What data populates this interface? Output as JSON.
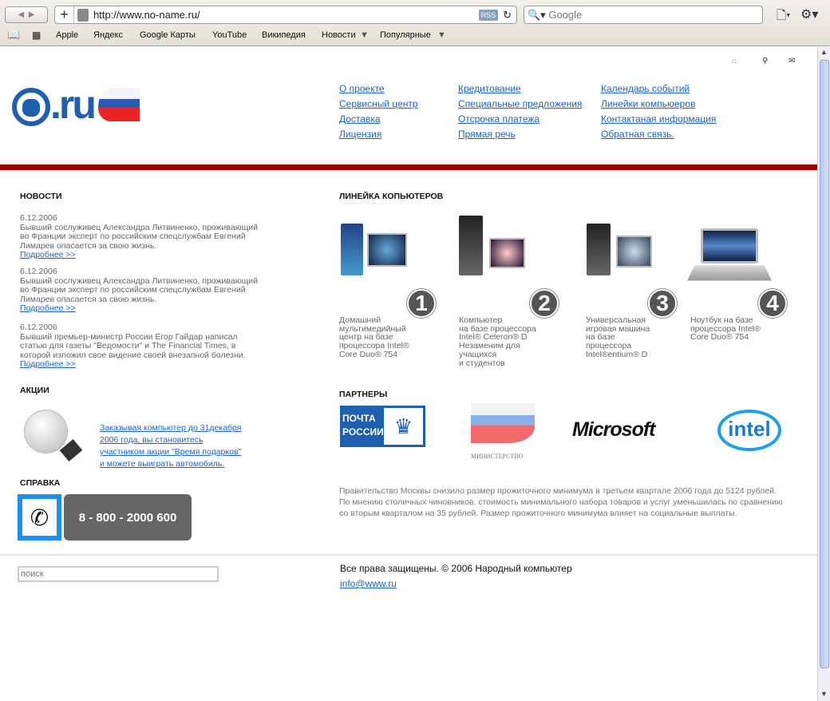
{
  "browser": {
    "url": "http://www.no-name.ru/",
    "rss": "RSS",
    "search_placeholder": "Google",
    "bookmarks": [
      "Apple",
      "Яндекс",
      "Google Карты",
      "YouTube",
      "Википедия",
      "Новости",
      "Популярные"
    ]
  },
  "nav": {
    "col1": [
      "О проекте",
      "Сервисный центр",
      "Доставка",
      "Лицензия"
    ],
    "col2": [
      "Кредитование",
      "Специальные предложения",
      "Отсрочка платежа",
      "Прямая речь"
    ],
    "col3": [
      "Календарь событий",
      "Линейки компьюеров",
      "Контактаная информация",
      "Обратная связь."
    ]
  },
  "logo_text": ".ru",
  "news": {
    "title": "НОВОСТИ",
    "items": [
      {
        "date": "6.12.2006",
        "text": "Бывший сослуживец Александра Литвиненко, проживающий во Франции эксперт по российским спецслужбам Евгений Лимарев опасается за свою жизнь.",
        "more": "Подробнее >>"
      },
      {
        "date": "6.12.2006",
        "text": "Бывший сослуживец Александра Литвиненко, проживающий во Франции эксперт по российским спецслужбам Евгений Лимарев опасается за свою жизнь.",
        "more": "Подробнее >>"
      },
      {
        "date": "6.12.2006",
        "text": "Бывший премьер-министр России Егор Гайдар написал статью для газеты \"Ведомости\" и The Financial Times, в которой изложил свое видение своей внезапной болезни.",
        "more": "Подробнее >>"
      }
    ]
  },
  "promo": {
    "title": "АКЦИИ",
    "text": "Заказывая компьютер до 31декабря 2006 года, вы становитесь участником акции \"Время подарков\" и можете выиграть автомобиль."
  },
  "help": {
    "title": "СПРАВКА",
    "phone": "8 - 800 - 2000 600"
  },
  "products": {
    "title": "ЛИНЕЙКА КОПЬЮТЕРОВ",
    "items": [
      {
        "num": "1",
        "lines": [
          "Домашний",
          "мультимедийный",
          "центр на базе",
          "процессора Intel®",
          "Core Duo® 754"
        ]
      },
      {
        "num": "2",
        "lines": [
          "Компьютер",
          "на базе процессора",
          "Intel® Celeron® D",
          "Незаменим для",
          "учащихся",
          "и студентов"
        ]
      },
      {
        "num": "3",
        "lines": [
          "Универсальная",
          "игровая машина",
          "на базе",
          "процессора",
          "Intel®entium® D"
        ]
      },
      {
        "num": "4",
        "lines": [
          "Ноутбук на базе",
          "процессора Intel®",
          "Core Duo® 754"
        ]
      }
    ]
  },
  "partners": {
    "title": "ПАРТНЕРЫ",
    "pochta": [
      "ПОЧТА",
      "РОССИИ"
    ],
    "ministry": "МИНИСТЕРСТВО",
    "microsoft": "Microsoft",
    "intel": "intel"
  },
  "article": "Правительство Москвы снизило размер прожиточного минимума в третьем квартале 2006 года до 5124 рублей. По мнению столичных чиновников, стоимость минимального набора товаров и услуг уменьшилась по сравнению со вторым кварталом на 35 рублей. Размер прожиточного минимума влияет на социальные выплаты.",
  "footer": {
    "search_placeholder": "поиск",
    "copyright": "Все права защищены. © 2006 Народный компьютер",
    "email": "info@www.ru"
  },
  "colors": {
    "accent_bar": "#990000",
    "link": "#1a63c9",
    "brand_blue": "#1e5fb0"
  }
}
